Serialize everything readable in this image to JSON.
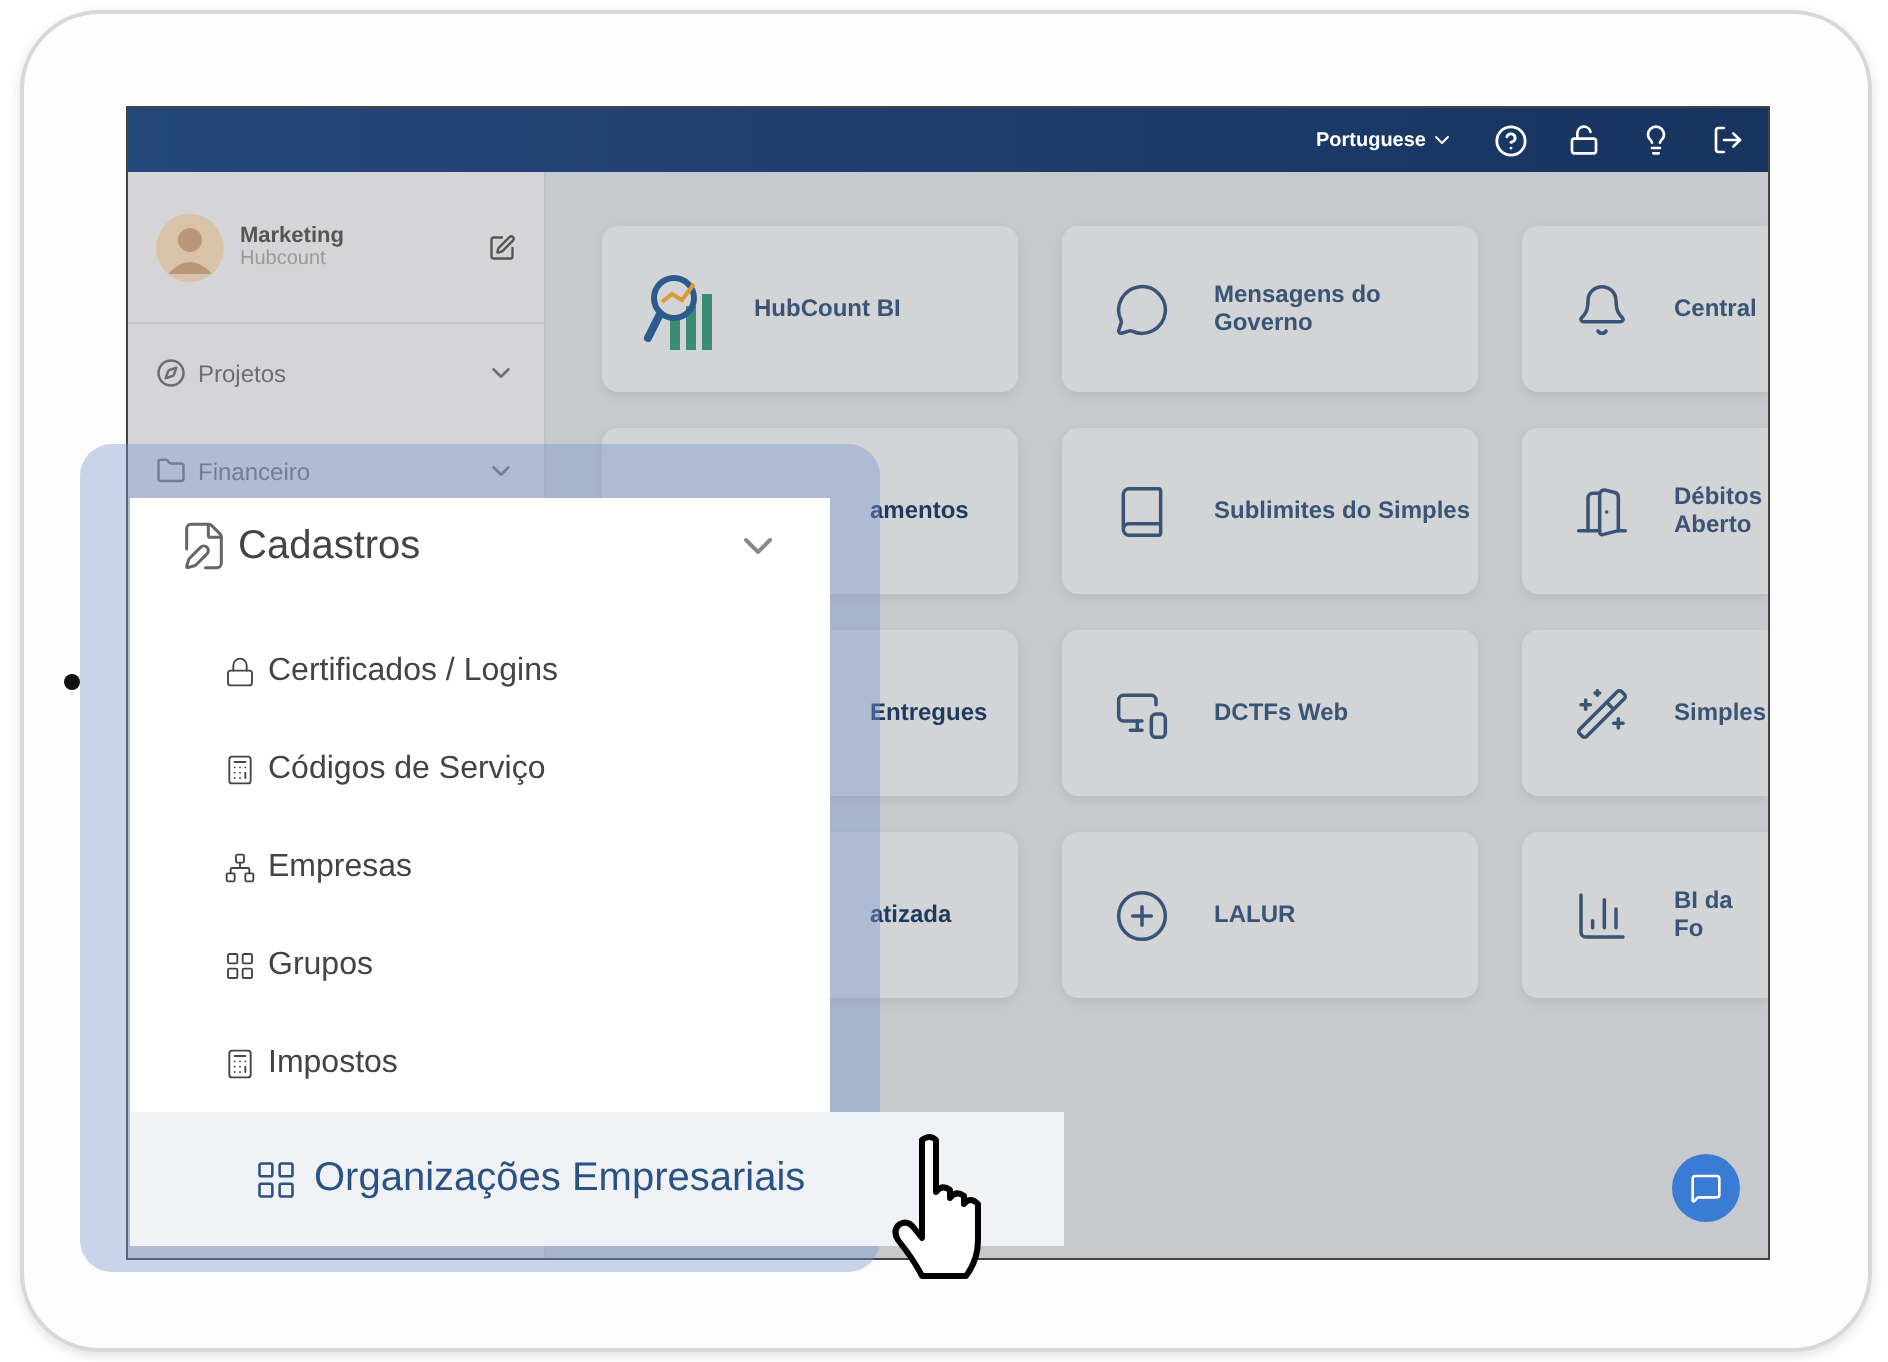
{
  "topbar": {
    "language": "Portuguese"
  },
  "sidebar": {
    "user": {
      "name": "Marketing",
      "company": "Hubcount"
    },
    "items": [
      {
        "label": "Projetos",
        "kind": "compass",
        "expanded": false
      },
      {
        "label": "Financeiro",
        "kind": "folder",
        "expanded": false
      }
    ]
  },
  "cards": [
    {
      "label": "HubCount BI",
      "kind": "bi"
    },
    {
      "label": "Mensagens do Governo",
      "kind": "chat"
    },
    {
      "label": "Central",
      "kind": "bell"
    },
    {
      "label": "amentos",
      "kind": "covered"
    },
    {
      "label": "Sublimites do Simples",
      "kind": "book"
    },
    {
      "label": "Débitos Aberto",
      "kind": "door"
    },
    {
      "label": "Entregues",
      "kind": "covered"
    },
    {
      "label": "DCTFs Web",
      "kind": "devices"
    },
    {
      "label": "Simples",
      "kind": "wand"
    },
    {
      "label": "atizada",
      "kind": "covered"
    },
    {
      "label": "LALUR",
      "kind": "plus"
    },
    {
      "label": "BI da Fo",
      "kind": "chart"
    }
  ],
  "menu": {
    "title": "Cadastros",
    "expanded": true,
    "items": [
      {
        "label": "Certificados / Logins",
        "kind": "lock",
        "selected": false
      },
      {
        "label": "Códigos de Serviço",
        "kind": "calculator",
        "selected": false
      },
      {
        "label": "Empresas",
        "kind": "network",
        "selected": false
      },
      {
        "label": "Grupos",
        "kind": "grid",
        "selected": false
      },
      {
        "label": "Impostos",
        "kind": "calculator",
        "selected": false
      },
      {
        "label": "Organizações Empresariais",
        "kind": "grid",
        "selected": true
      }
    ]
  }
}
